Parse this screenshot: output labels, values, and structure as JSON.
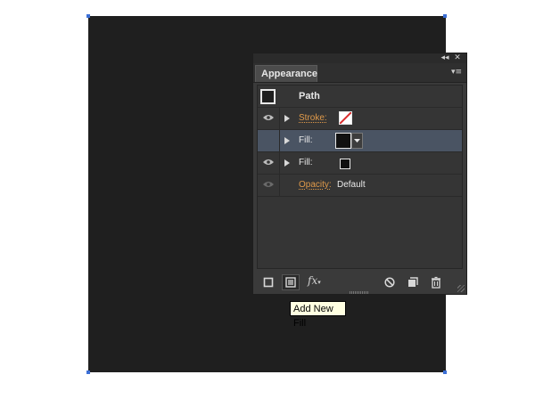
{
  "canvas": {
    "fill_color": "#1f1f1f",
    "selection_color": "#3b6fd6"
  },
  "panel": {
    "title": "Appearance",
    "collapse_glyph": "◂◂",
    "close_glyph": "✕",
    "menu_glyph": "▾≡",
    "header": {
      "label": "Path"
    },
    "rows": [
      {
        "label": "Stroke:",
        "label_style": "link",
        "visible": true,
        "has_arrow": true,
        "swatch": "none"
      },
      {
        "label": "Fill:",
        "label_style": "plain",
        "visible": false,
        "has_arrow": true,
        "swatch": "black",
        "selected": true
      },
      {
        "label": "Fill:",
        "label_style": "plain",
        "visible": true,
        "has_arrow": true,
        "swatch": "black-small"
      },
      {
        "label": "Opacity:",
        "label_style": "link",
        "visible": true,
        "has_arrow": false,
        "value": "Default"
      }
    ],
    "footer_fx": "fx",
    "footer_fx_caret": "▾"
  },
  "tooltip": {
    "text": "Add New Fill"
  },
  "colors": {
    "panel_bg": "#3a3a3a",
    "selected_row": "#4a5463",
    "link_label": "#e09a4a",
    "stroke_slash": "#d92b2b"
  }
}
